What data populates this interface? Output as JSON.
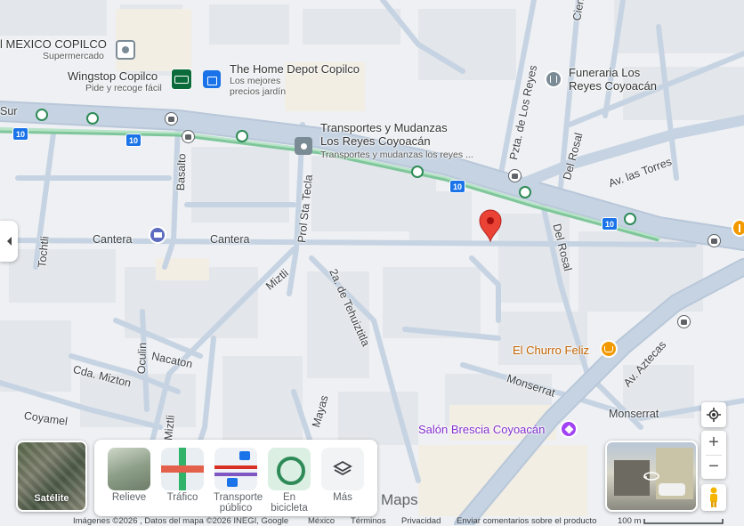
{
  "places": [
    {
      "name": "l MEXICO COPILCO",
      "sub": "Supermercado"
    },
    {
      "name": "Wingstop Copilco",
      "sub": "Pide y recoge fácil"
    },
    {
      "name": "The Home Depot Copilco",
      "sub_lines": [
        "Los mejores",
        "precios jardín"
      ]
    },
    {
      "name": "Transportes y Mudanzas",
      "name2": "Los Reyes Coyoacán",
      "sub": "Transportes y mudanzas los reyes ..."
    },
    {
      "name_lines": [
        "Funeraria Los",
        "Reyes Coyoacán"
      ]
    },
    {
      "name": "El Churro Feliz"
    },
    {
      "name": "Salón Brescia Coyoacán"
    }
  ],
  "streets": [
    "Sur",
    "Pzta. de Los Reyes",
    "Cien",
    "Del Rosal",
    "Av. las Torres",
    "Basalto",
    "Prol Sta Tecla",
    "Cantera",
    "Cantera",
    "Tochtli",
    "Miztli",
    "2a. de Tehuiztitla",
    "Del Rosal",
    "Cda. Mizton",
    "Nacaton",
    "Oculin",
    "Coyamel",
    "Miztli",
    "Mayas",
    "Monserrat",
    "Monserrat",
    "Av. Aztecas"
  ],
  "route_shield": "10",
  "layers": [
    {
      "label": "Satélite"
    },
    {
      "label": "Relieve"
    },
    {
      "label": "Tráfico"
    },
    {
      "label_lines": [
        "Transporte",
        "público"
      ]
    },
    {
      "label_lines": [
        "En",
        "bicicleta"
      ]
    },
    {
      "label": "Más"
    }
  ],
  "logo": "Maps",
  "footer": {
    "imagery": "Imágenes ©2026 , Datos del mapa ©2026 INEGI, Google",
    "country": "México",
    "terms": "Términos",
    "privacy": "Privacidad",
    "feedback": "Enviar comentarios sobre el producto",
    "scale": "100 m"
  },
  "colors": {
    "road": "#c6d3e2",
    "marker": "#ea4335",
    "transit_green": "#b7e4c7",
    "shield_blue": "#1a73e8",
    "poi_blue": "#1a73e8",
    "poi_orange": "#f29900",
    "poi_purple": "#a142f4",
    "poi_gray": "#7b8b96"
  }
}
